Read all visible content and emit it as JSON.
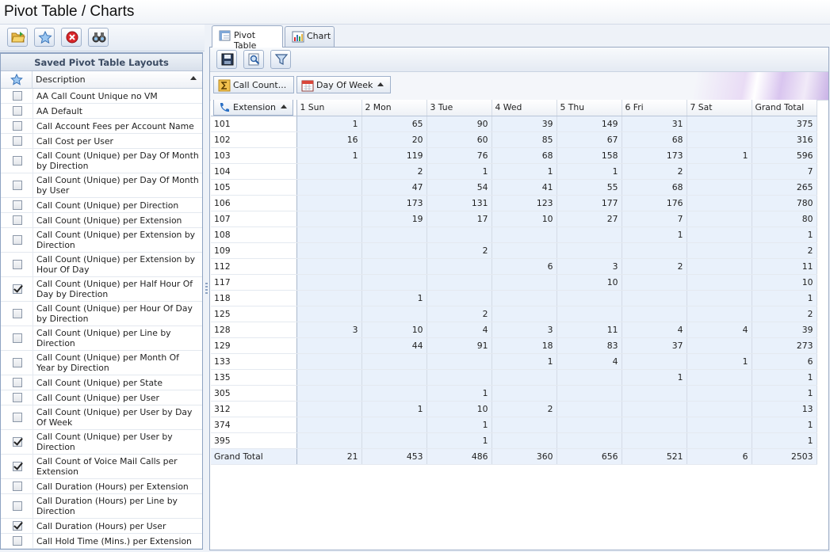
{
  "window": {
    "title": "Pivot Table / Charts"
  },
  "left_panel": {
    "header": "Saved Pivot Table Layouts",
    "column_description": "Description",
    "layouts": [
      {
        "label": "AA Call Count Unique no VM",
        "favorite": false
      },
      {
        "label": "AA Default",
        "favorite": false
      },
      {
        "label": "Call Account Fees per Account Name",
        "favorite": false
      },
      {
        "label": "Call Cost per User",
        "favorite": false
      },
      {
        "label": "Call Count (Unique) per Day Of Month by Direction",
        "favorite": false
      },
      {
        "label": "Call Count (Unique) per Day Of Month by User",
        "favorite": false
      },
      {
        "label": "Call Count (Unique) per Direction",
        "favorite": false
      },
      {
        "label": "Call Count (Unique) per Extension",
        "favorite": false
      },
      {
        "label": "Call Count (Unique) per Extension by Direction",
        "favorite": false
      },
      {
        "label": "Call Count (Unique) per Extension by Hour Of Day",
        "favorite": false
      },
      {
        "label": "Call Count (Unique) per Half Hour Of Day by Direction",
        "favorite": true
      },
      {
        "label": "Call Count (Unique) per Hour Of Day by Direction",
        "favorite": false
      },
      {
        "label": "Call Count (Unique) per Line by Direction",
        "favorite": false
      },
      {
        "label": "Call Count (Unique) per Month Of Year by Direction",
        "favorite": false
      },
      {
        "label": "Call Count (Unique) per State",
        "favorite": false
      },
      {
        "label": "Call Count (Unique) per User",
        "favorite": false
      },
      {
        "label": "Call Count (Unique) per User by Day Of Week",
        "favorite": false
      },
      {
        "label": "Call Count (Unique) per User by Direction",
        "favorite": true
      },
      {
        "label": "Call Count of Voice Mail Calls per Extension",
        "favorite": true
      },
      {
        "label": "Call Duration (Hours) per Extension",
        "favorite": false
      },
      {
        "label": "Call Duration (Hours) per Line by Direction",
        "favorite": false
      },
      {
        "label": "Call Duration (Hours) per User",
        "favorite": true
      },
      {
        "label": "Call Hold Time (Mins.) per Extension",
        "favorite": false
      }
    ]
  },
  "tabs": [
    {
      "label": "Pivot Table",
      "active": true
    },
    {
      "label": "Chart",
      "active": false
    }
  ],
  "pivot": {
    "data_field": "Call Count...",
    "column_field": "Day Of Week",
    "row_field": "Extension",
    "columns": [
      "1 Sun",
      "2 Mon",
      "3 Tue",
      "4 Wed",
      "5 Thu",
      "6 Fri",
      "7 Sat",
      "Grand Total"
    ],
    "rows": [
      {
        "label": "101",
        "values": [
          "1",
          "65",
          "90",
          "39",
          "149",
          "31",
          "",
          "375"
        ]
      },
      {
        "label": "102",
        "values": [
          "16",
          "20",
          "60",
          "85",
          "67",
          "68",
          "",
          "316"
        ]
      },
      {
        "label": "103",
        "values": [
          "1",
          "119",
          "76",
          "68",
          "158",
          "173",
          "1",
          "596"
        ]
      },
      {
        "label": "104",
        "values": [
          "",
          "2",
          "1",
          "1",
          "1",
          "2",
          "",
          "7"
        ]
      },
      {
        "label": "105",
        "values": [
          "",
          "47",
          "54",
          "41",
          "55",
          "68",
          "",
          "265"
        ]
      },
      {
        "label": "106",
        "values": [
          "",
          "173",
          "131",
          "123",
          "177",
          "176",
          "",
          "780"
        ]
      },
      {
        "label": "107",
        "values": [
          "",
          "19",
          "17",
          "10",
          "27",
          "7",
          "",
          "80"
        ]
      },
      {
        "label": "108",
        "values": [
          "",
          "",
          "",
          "",
          "",
          "1",
          "",
          "1"
        ]
      },
      {
        "label": "109",
        "values": [
          "",
          "",
          "2",
          "",
          "",
          "",
          "",
          "2"
        ]
      },
      {
        "label": "112",
        "values": [
          "",
          "",
          "",
          "6",
          "3",
          "2",
          "",
          "11"
        ]
      },
      {
        "label": "117",
        "values": [
          "",
          "",
          "",
          "",
          "10",
          "",
          "",
          "10"
        ]
      },
      {
        "label": "118",
        "values": [
          "",
          "1",
          "",
          "",
          "",
          "",
          "",
          "1"
        ]
      },
      {
        "label": "125",
        "values": [
          "",
          "",
          "2",
          "",
          "",
          "",
          "",
          "2"
        ]
      },
      {
        "label": "128",
        "values": [
          "3",
          "10",
          "4",
          "3",
          "11",
          "4",
          "4",
          "39"
        ]
      },
      {
        "label": "129",
        "values": [
          "",
          "44",
          "91",
          "18",
          "83",
          "37",
          "",
          "273"
        ]
      },
      {
        "label": "133",
        "values": [
          "",
          "",
          "",
          "1",
          "4",
          "",
          "1",
          "6"
        ]
      },
      {
        "label": "135",
        "values": [
          "",
          "",
          "",
          "",
          "",
          "1",
          "",
          "1"
        ]
      },
      {
        "label": "305",
        "values": [
          "",
          "",
          "1",
          "",
          "",
          "",
          "",
          "1"
        ]
      },
      {
        "label": "312",
        "values": [
          "",
          "1",
          "10",
          "2",
          "",
          "",
          "",
          "13"
        ]
      },
      {
        "label": "374",
        "values": [
          "",
          "",
          "1",
          "",
          "",
          "",
          "",
          "1"
        ]
      },
      {
        "label": "395",
        "values": [
          "",
          "",
          "1",
          "",
          "",
          "",
          "",
          "1"
        ]
      }
    ],
    "grand_total": {
      "label": "Grand Total",
      "values": [
        "21",
        "453",
        "486",
        "360",
        "656",
        "521",
        "6",
        "2503"
      ]
    }
  },
  "colors": {
    "accent": "#3a6ea5",
    "panel_border": "#8ea3c2",
    "cell_background": "#e9f1fb"
  }
}
